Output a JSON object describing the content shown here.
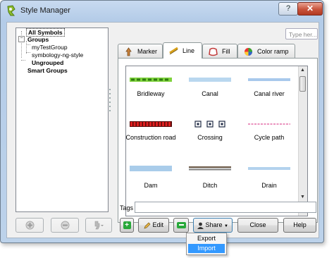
{
  "window": {
    "title": "Style Manager",
    "help_glyph": "?",
    "close_glyph": "✕"
  },
  "tree": {
    "items": [
      {
        "label": "All Symbols",
        "selected": true
      },
      {
        "label": "Groups",
        "expanded": true
      },
      {
        "label": "myTestGroup"
      },
      {
        "label": "symbology-ng-style"
      },
      {
        "label": "Ungrouped"
      },
      {
        "label": "Smart Groups"
      }
    ]
  },
  "search": {
    "placeholder": "Type her..."
  },
  "tabs": [
    {
      "label": "Marker",
      "icon": "marker-icon"
    },
    {
      "label": "Line",
      "icon": "line-icon",
      "active": true
    },
    {
      "label": "Fill",
      "icon": "fill-icon"
    },
    {
      "label": "Color ramp",
      "icon": "color-ramp-icon"
    }
  ],
  "symbols": [
    {
      "name": "Bridleway",
      "style": "green-dashed"
    },
    {
      "name": "Canal",
      "style": "light-blue"
    },
    {
      "name": "Canal river",
      "style": "blue-thin"
    },
    {
      "name": "Construction road",
      "style": "red-dotted"
    },
    {
      "name": "Crossing",
      "style": "boxes"
    },
    {
      "name": "Cycle path",
      "style": "pink-dashed"
    },
    {
      "name": "Dam",
      "style": "blue-thick"
    },
    {
      "name": "Ditch",
      "style": "brown-double"
    },
    {
      "name": "Drain",
      "style": "blue-thin"
    }
  ],
  "tags": {
    "label": "Tags",
    "value": ""
  },
  "buttons": {
    "add_group": "add-group-icon",
    "remove_group": "remove-group-icon",
    "group_menu": "group-tools-icon",
    "add_symbol": "+",
    "edit": "Edit",
    "remove_symbol": "remove-symbol-icon",
    "share": "Share",
    "close": "Close",
    "help": "Help"
  },
  "share_menu": {
    "items": [
      {
        "label": "Export"
      },
      {
        "label": "Import",
        "highlighted": true
      }
    ]
  },
  "colors": {
    "titlebar": "#c8daf0",
    "highlight": "#3399ff",
    "green": "#28a83a",
    "close_red": "#c8533b"
  }
}
